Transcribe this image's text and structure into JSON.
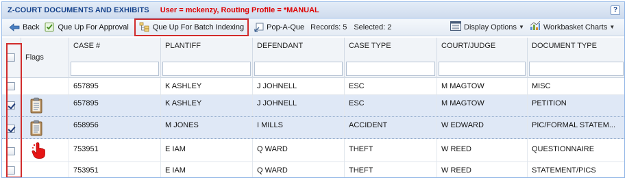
{
  "title": "Z-COURT DOCUMENTS AND EXHIBITS",
  "user_info": "User = mckenzy, Routing Profile = *MANUAL",
  "help_label": "?",
  "toolbar": {
    "back": "Back",
    "queue_approval": "Que Up For Approval",
    "queue_batch": "Que Up For Batch Indexing",
    "pop_a_que": "Pop-A-Que",
    "records": "Records: 5",
    "selected": "Selected: 2",
    "display_options": "Display Options",
    "workbasket_charts": "Workbasket Charts"
  },
  "columns": {
    "flags": "Flags",
    "case": "CASE #",
    "plaintiff": "PLANTIFF",
    "defendant": "DEFENDANT",
    "case_type": "CASE TYPE",
    "court": "COURT/JUDGE",
    "doc_type": "DOCUMENT TYPE"
  },
  "rows": [
    {
      "checked": false,
      "flag": "",
      "case": "657895",
      "plaintiff": "K ASHLEY",
      "defendant": "J JOHNELL",
      "case_type": "ESC",
      "court": "M MAGTOW",
      "doc_type": "MISC"
    },
    {
      "checked": true,
      "flag": "clipboard-icon",
      "case": "657895",
      "plaintiff": "K ASHLEY",
      "defendant": "J JOHNELL",
      "case_type": "ESC",
      "court": "M MAGTOW",
      "doc_type": "PETITION"
    },
    {
      "checked": true,
      "flag": "clipboard-icon",
      "case": "658956",
      "plaintiff": "M JONES",
      "defendant": "I MILLS",
      "case_type": "ACCIDENT",
      "court": "W EDWARD",
      "doc_type": "PIC/FORMAL STATEM..."
    },
    {
      "checked": false,
      "flag": "hand-pointer-icon",
      "case": "753951",
      "plaintiff": "E IAM",
      "defendant": "Q WARD",
      "case_type": "THEFT",
      "court": "W REED",
      "doc_type": "QUESTIONNAIRE"
    },
    {
      "checked": false,
      "flag": "",
      "case": "753951",
      "plaintiff": "E IAM",
      "defendant": "Q WARD",
      "case_type": "THEFT",
      "court": "W REED",
      "doc_type": "STATEMENT/PICS"
    }
  ],
  "colors": {
    "title": "#15428b",
    "user": "#dd0000",
    "highlight": "#d12b2b",
    "selected_row": "#dfe8f6"
  }
}
